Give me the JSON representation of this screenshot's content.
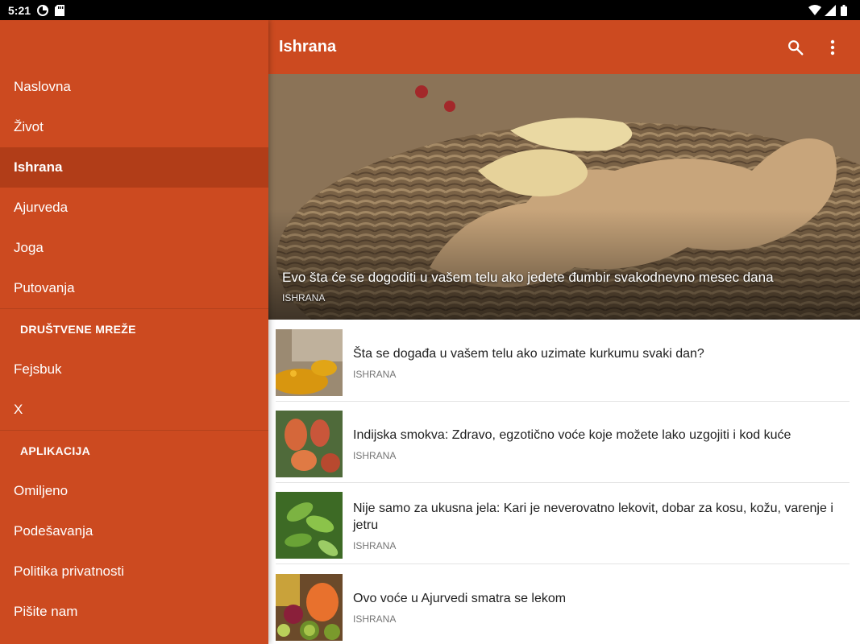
{
  "status_bar": {
    "time": "5:21",
    "icons_left": [
      "data-saver-icon",
      "sd-card-icon"
    ],
    "icons_right": [
      "wifi-icon",
      "signal-icon",
      "battery-icon"
    ]
  },
  "colors": {
    "primary": "#cc4a20",
    "primary_dark": "#b13d18",
    "text_primary": "#212121",
    "text_secondary": "#757575"
  },
  "drawer": {
    "items_main": [
      {
        "label": "Naslovna",
        "active": false
      },
      {
        "label": "Život",
        "active": false
      },
      {
        "label": "Ishrana",
        "active": true
      },
      {
        "label": "Ajurveda",
        "active": false
      },
      {
        "label": "Joga",
        "active": false
      },
      {
        "label": "Putovanja",
        "active": false
      }
    ],
    "section_social": "DRUŠTVENE MREŽE",
    "items_social": [
      {
        "label": "Fejsbuk"
      },
      {
        "label": "X"
      }
    ],
    "section_app": "APLIKACIJA",
    "items_app": [
      {
        "label": "Omiljeno"
      },
      {
        "label": "Podešavanja"
      },
      {
        "label": "Politika privatnosti"
      },
      {
        "label": "Pišite nam"
      }
    ]
  },
  "app_bar": {
    "title": "Ishrana",
    "actions": [
      "search-icon",
      "more-vert-icon"
    ]
  },
  "hero": {
    "title": "Evo šta će se dogoditi u vašem telu ako jedete đumbir svakodnevno mesec dana",
    "category": "ISHRANA"
  },
  "articles": [
    {
      "title": "Šta se događa u vašem telu ako uzimate kurkumu svaki dan?",
      "category": "ISHRANA",
      "thumb": "turmeric"
    },
    {
      "title": "Indijska smokva: Zdravo, egzotično voće koje možete lako uzgojiti i kod kuće",
      "category": "ISHRANA",
      "thumb": "prickly-pear"
    },
    {
      "title": "Nije samo za ukusna jela: Kari je neverovatno lekovit, dobar za kosu, kožu, varenje i jetru",
      "category": "ISHRANA",
      "thumb": "curry-leaves"
    },
    {
      "title": "Ovo voće u Ajurvedi smatra se lekom",
      "category": "ISHRANA",
      "thumb": "fruits"
    }
  ]
}
